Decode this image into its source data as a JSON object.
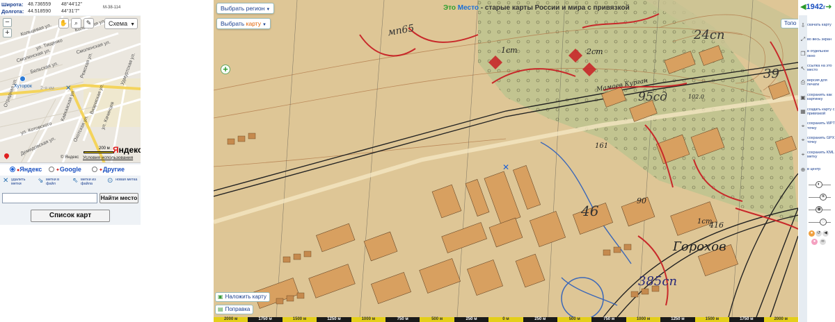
{
  "coords": {
    "lat_label": "Широта:",
    "lat_value": "48.736559",
    "lat_dms": "48°44'12\"",
    "lon_label": "Долгота:",
    "lon_value": "44.518590",
    "lon_dms": "44°31'7\"",
    "sheet": "М-38-114"
  },
  "minimap": {
    "scheme_label": "Схема",
    "hutorok": "Хуторок",
    "scale_label": "200 м",
    "logo_y": "Я",
    "logo_rest": "ндекс",
    "copyright": "© Яндекс",
    "terms": "Условия использования",
    "streets": [
      "Кольцевая ул.",
      "Кольцевая ул.",
      "ул. Тищенко",
      "Смоленская ул.",
      "Смоленская ул.",
      "Бельская ул.",
      "Режская ул.",
      "Вяземская ул.",
      "ул. Качинцев",
      "Кавказская ул.",
      "Охотская ул.",
      "Отрадная ул.",
      "ул. Котовского",
      "Демидовская ул.",
      "Удмуртская ул.",
      "2-я км"
    ]
  },
  "providers": [
    {
      "label": "Яндекс",
      "selected": true
    },
    {
      "label": "Google",
      "selected": false
    },
    {
      "label": "Другие",
      "selected": false
    }
  ],
  "actions": [
    {
      "icon": "remove-markers-icon",
      "label": "удалить метки"
    },
    {
      "icon": "markers-to-file-icon",
      "label": "метки в файл"
    },
    {
      "icon": "markers-from-file-icon",
      "label": "метки из файла"
    },
    {
      "icon": "new-marker-icon",
      "label": "новая метка"
    }
  ],
  "search": {
    "value": "",
    "button": "Найти место"
  },
  "maps_list_button": "Список карт",
  "map": {
    "choose_region": "Выбрать регион",
    "choose_map_prefix": "Выбрать ",
    "choose_map_word": "карту",
    "title_part1": "Это",
    "title_part2": "Место",
    "title_rest": " - старые карты России и мира с привязкой",
    "topo": "Топо",
    "overlay_button": "Наложить карту",
    "correction_button": "Поправка",
    "labels": [
      "мп65",
      "1ст",
      "2ст",
      "24сп",
      "Мамаев Курган",
      "95сд",
      "102.0",
      "161",
      "416",
      "Горохов",
      "385сп",
      "90",
      "46",
      "1ст",
      "39"
    ]
  },
  "scale_segments": [
    {
      "label": "2000 м",
      "color": "y"
    },
    {
      "label": "1750 м",
      "color": "k"
    },
    {
      "label": "1500 м",
      "color": "y"
    },
    {
      "label": "1250 м",
      "color": "k"
    },
    {
      "label": "1000 м",
      "color": "y"
    },
    {
      "label": "750 м",
      "color": "k"
    },
    {
      "label": "500 м",
      "color": "y"
    },
    {
      "label": "250 м",
      "color": "k"
    },
    {
      "label": "0 м",
      "color": "y"
    },
    {
      "label": "250 м",
      "color": "k"
    },
    {
      "label": "500 м",
      "color": "y"
    },
    {
      "label": "750 м",
      "color": "k"
    },
    {
      "label": "1000 м",
      "color": "y"
    },
    {
      "label": "1250 м",
      "color": "k"
    },
    {
      "label": "1500 м",
      "color": "y"
    },
    {
      "label": "1750 м",
      "color": "k"
    },
    {
      "label": "2000 м",
      "color": "y"
    }
  ],
  "year": {
    "value": "1942",
    "suffix": "г"
  },
  "right_panel": [
    {
      "icon": "download-icon",
      "label": "скачать карту"
    },
    {
      "icon": "fullscreen-icon",
      "label": "во весь экран"
    },
    {
      "icon": "new-window-icon",
      "label": "в отдельное окно"
    },
    {
      "icon": "link-icon",
      "label": "ссылка на это место"
    },
    {
      "icon": "print-icon",
      "label": "версия для печати"
    },
    {
      "icon": "save-image-icon",
      "label": "сохранить как картинку"
    },
    {
      "icon": "georef-icon",
      "label": "создать карту с привязкой"
    },
    {
      "icon": "wpt-icon",
      "label": "сохранить WPT точку"
    },
    {
      "icon": "gpx-icon",
      "label": "сохранить GPX точку"
    },
    {
      "icon": "kml-icon",
      "label": "сохранить KML метку"
    },
    {
      "icon": "center-icon",
      "label": "в центр"
    }
  ]
}
